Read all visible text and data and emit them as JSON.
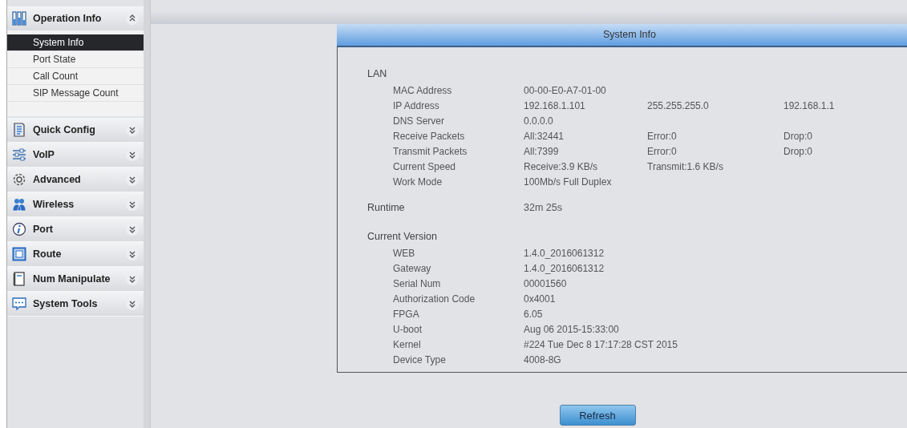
{
  "sidebar": {
    "groups": [
      {
        "label": "Operation Info",
        "expanded": true,
        "items": [
          {
            "label": "System Info",
            "selected": true
          },
          {
            "label": "Port State",
            "selected": false
          },
          {
            "label": "Call Count",
            "selected": false
          },
          {
            "label": "SIP Message Count",
            "selected": false
          }
        ]
      },
      {
        "label": "Quick Config",
        "expanded": false
      },
      {
        "label": "VoIP",
        "expanded": false
      },
      {
        "label": "Advanced",
        "expanded": false
      },
      {
        "label": "Wireless",
        "expanded": false
      },
      {
        "label": "Port",
        "expanded": false
      },
      {
        "label": "Route",
        "expanded": false
      },
      {
        "label": "Num Manipulate",
        "expanded": false
      },
      {
        "label": "System Tools",
        "expanded": false
      }
    ]
  },
  "panel": {
    "title": "System Info",
    "sections": [
      {
        "title": "LAN",
        "rows": [
          {
            "label": "MAC Address",
            "values": [
              "00-00-E0-A7-01-00"
            ]
          },
          {
            "label": "IP Address",
            "values": [
              "192.168.1.101",
              "255.255.255.0",
              "192.168.1.1"
            ]
          },
          {
            "label": "DNS Server",
            "values": [
              "0.0.0.0"
            ]
          },
          {
            "label": "Receive Packets",
            "values": [
              "All:32441",
              "Error:0",
              "Drop:0"
            ]
          },
          {
            "label": "Transmit Packets",
            "values": [
              "All:7399",
              "Error:0",
              "Drop:0"
            ]
          },
          {
            "label": "Current Speed",
            "values": [
              "Receive:3.9 KB/s",
              "Transmit:1.6 KB/s"
            ]
          },
          {
            "label": "Work Mode",
            "values": [
              "100Mb/s Full Duplex"
            ]
          }
        ]
      },
      {
        "title": "Runtime",
        "value": "32m 25s"
      },
      {
        "title": "Current Version",
        "rows": [
          {
            "label": "WEB",
            "values": [
              "1.4.0_2016061312"
            ]
          },
          {
            "label": "Gateway",
            "values": [
              "1.4.0_2016061312"
            ]
          },
          {
            "label": "Serial Num",
            "values": [
              "00001560"
            ]
          },
          {
            "label": "Authorization Code",
            "values": [
              "0x4001"
            ]
          },
          {
            "label": "FPGA",
            "values": [
              "6.05"
            ]
          },
          {
            "label": "U-boot",
            "values": [
              "Aug 06 2015-15:33:00"
            ]
          },
          {
            "label": "Kernel",
            "values": [
              "#224 Tue Dec 8 17:17:28 CST 2015"
            ]
          },
          {
            "label": "Device Type",
            "values": [
              "4008-8G"
            ]
          }
        ]
      }
    ],
    "button": "Refresh"
  }
}
